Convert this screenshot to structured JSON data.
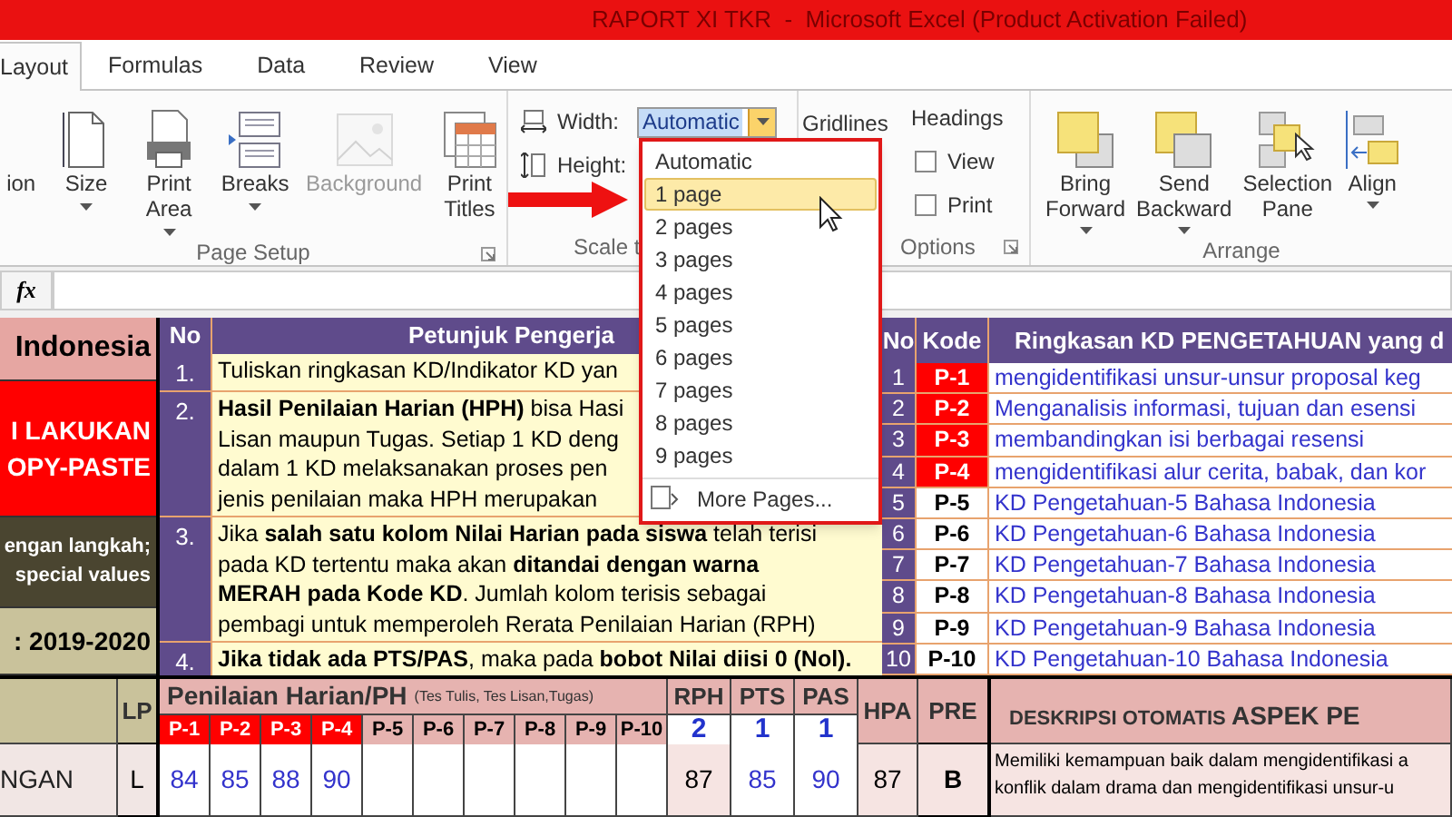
{
  "window": {
    "title": "RAPORT XI TKR  -  Microsoft Excel (Product Activation Failed)"
  },
  "tabs": [
    {
      "label": "Layout",
      "selected": true
    },
    {
      "label": "Formulas",
      "selected": false
    },
    {
      "label": "Data",
      "selected": false
    },
    {
      "label": "Review",
      "selected": false
    },
    {
      "label": "View",
      "selected": false
    }
  ],
  "page_setup": {
    "label": "Page Setup",
    "buttons": [
      {
        "label": "ion",
        "caret": false,
        "disabled": false
      },
      {
        "label": "Size",
        "caret": true,
        "disabled": false
      },
      {
        "label": "Print\nArea",
        "caret": true,
        "disabled": false
      },
      {
        "label": "Breaks",
        "caret": true,
        "disabled": false
      },
      {
        "label": "Background",
        "caret": false,
        "disabled": true
      },
      {
        "label": "Print\nTitles",
        "caret": false,
        "disabled": false
      }
    ]
  },
  "scale_to_fit": {
    "label": "Scale t",
    "width_label": "Width:",
    "width_value": "Automatic",
    "width_menu": true,
    "height_label": "Height:"
  },
  "sheet_options": {
    "label": "Options",
    "gridlines": "Gridlines",
    "headings": "Headings",
    "checks": [
      {
        "label": "View",
        "checked": false
      },
      {
        "label": "Print",
        "checked": false
      }
    ]
  },
  "arrange": {
    "label": "Arrange",
    "buttons": [
      {
        "label": "Bring\nForward",
        "caret": true
      },
      {
        "label": "Send\nBackward",
        "caret": true
      },
      {
        "label": "Selection\nPane",
        "caret": false
      },
      {
        "label": "Align",
        "caret": true
      }
    ]
  },
  "width_menu": {
    "items": [
      {
        "label": "Automatic",
        "selected": false
      },
      {
        "label": "1 page",
        "selected": true
      },
      {
        "label": "2 pages",
        "selected": false
      },
      {
        "label": "3 pages",
        "selected": false
      },
      {
        "label": "4 pages",
        "selected": false
      },
      {
        "label": "5 pages",
        "selected": false
      },
      {
        "label": "6 pages",
        "selected": false
      },
      {
        "label": "7 pages",
        "selected": false
      },
      {
        "label": "8 pages",
        "selected": false
      },
      {
        "label": "9 pages",
        "selected": false
      }
    ],
    "more": "More Pages..."
  },
  "formula_bar": {
    "function_label": "fx"
  },
  "side_notes": [
    {
      "text": "Indonesia",
      "kind": "title"
    },
    {
      "text": "I LAKUKAN\nOPY-PASTE",
      "kind": "warning"
    },
    {
      "text": "engan langkah;\nspecial values",
      "kind": "note"
    },
    {
      "text": ": 2019-2020",
      "kind": "year"
    }
  ],
  "instructions": {
    "columns": [
      "No",
      "Petunjuk Pengerja"
    ],
    "rows": [
      {
        "no": "1.",
        "text": "Tuliskan ringkasan KD/Indikator KD yan"
      },
      {
        "no": "2.",
        "text": "**Hasil Penilaian Harian (HPH)** bisa Hasi\nLisan maupun Tugas. Setiap 1 KD deng\ndalam 1 KD melaksanakan proses pen\njenis penilaian maka HPH merupakan"
      },
      {
        "no": "3.",
        "text": "Jika **salah satu kolom Nilai Harian pada siswa** telah terisi\npada KD tertentu maka akan **ditandai dengan warna**\n**MERAH pada Kode KD**. Jumlah kolom terisis sebagai\npembagi untuk memperoleh Rerata Penilaian Harian (RPH)"
      },
      {
        "no": "4.",
        "text": "**Jika tidak ada PTS/PAS**, maka pada **bobot Nilai diisi 0 (Nol).**"
      }
    ]
  },
  "kd_table": {
    "columns": [
      "No",
      "Kode",
      "Ringkasan KD PENGETAHUAN yang d"
    ],
    "rows": [
      {
        "no": "1",
        "code": "P-1",
        "filled": true,
        "text": "mengidentifikasi unsur-unsur proposal keg"
      },
      {
        "no": "2",
        "code": "P-2",
        "filled": true,
        "text": "Menganalisis informasi, tujuan dan esensi"
      },
      {
        "no": "3",
        "code": "P-3",
        "filled": true,
        "text": "membandingkan isi berbagai resensi"
      },
      {
        "no": "4",
        "code": "P-4",
        "filled": true,
        "text": "mengidentifikasi alur cerita, babak, dan kor"
      },
      {
        "no": "5",
        "code": "P-5",
        "filled": false,
        "text": "KD Pengetahuan-5 Bahasa Indonesia"
      },
      {
        "no": "6",
        "code": "P-6",
        "filled": false,
        "text": "KD Pengetahuan-6 Bahasa Indonesia"
      },
      {
        "no": "7",
        "code": "P-7",
        "filled": false,
        "text": "KD Pengetahuan-7 Bahasa Indonesia"
      },
      {
        "no": "8",
        "code": "P-8",
        "filled": false,
        "text": "KD Pengetahuan-8 Bahasa Indonesia"
      },
      {
        "no": "9",
        "code": "P-9",
        "filled": false,
        "text": "KD Pengetahuan-9 Bahasa Indonesia"
      },
      {
        "no": "10",
        "code": "P-10",
        "filled": false,
        "text": "KD Pengetahuan-10 Bahasa Indonesia"
      }
    ]
  },
  "grades": {
    "lp_header": "LP",
    "ph_title": "Penilaian Harian/PH",
    "ph_note": "(Tes Tulis, Tes Lisan,Tugas)",
    "codes": [
      {
        "code": "P-1",
        "filled": true
      },
      {
        "code": "P-2",
        "filled": true
      },
      {
        "code": "P-3",
        "filled": true
      },
      {
        "code": "P-4",
        "filled": true
      },
      {
        "code": "P-5",
        "filled": false
      },
      {
        "code": "P-6",
        "filled": false
      },
      {
        "code": "P-7",
        "filled": false
      },
      {
        "code": "P-8",
        "filled": false
      },
      {
        "code": "P-9",
        "filled": false
      },
      {
        "code": "P-10",
        "filled": false
      }
    ],
    "weights": [
      {
        "label": "RPH",
        "weight": "2"
      },
      {
        "label": "PTS",
        "weight": "1"
      },
      {
        "label": "PAS",
        "weight": "1"
      }
    ],
    "hpa_header": "HPA",
    "pre_header": "PRE",
    "description_header": "DESKRIPSI OTOMATIS **ASPEK PE**",
    "rows": [
      {
        "name": "NGAN",
        "lp": "L",
        "scores": [
          "84",
          "85",
          "88",
          "90"
        ],
        "rph": "87",
        "pts": "85",
        "pas": "90",
        "hpa": "87",
        "pre": "B",
        "description": "Memiliki kemampuan baik dalam mengidentifikasi a\nkonflik dalam drama dan mengidentifikasi unsur-u"
      }
    ]
  }
}
